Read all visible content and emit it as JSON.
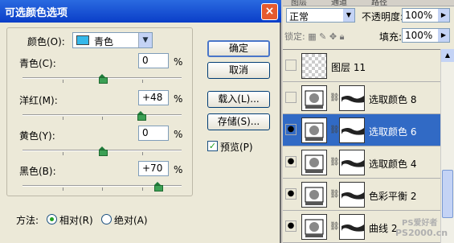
{
  "dialog": {
    "title": "可选颜色选项",
    "close_symbol": "×",
    "color_label": "颜色(O):",
    "color_value": "青色",
    "color_swatch": "#35b8ea",
    "sliders": [
      {
        "label": "青色(C):",
        "value": "0",
        "unit": "%",
        "level": 0
      },
      {
        "label": "洋红(M):",
        "value": "+48",
        "unit": "%",
        "level": 48
      },
      {
        "label": "黄色(Y):",
        "value": "0",
        "unit": "%",
        "level": 0
      },
      {
        "label": "黑色(B):",
        "value": "+70",
        "unit": "%",
        "level": 70
      }
    ],
    "buttons": {
      "ok": "确定",
      "cancel": "取消",
      "load": "载入(L)...",
      "save": "存储(S)..."
    },
    "preview_label": "预览(P)",
    "preview_checked": true,
    "method_label": "方法:",
    "method_relative": "相对(R)",
    "method_absolute": "绝对(A)",
    "method_selected": "relative"
  },
  "layers_panel": {
    "tabs": [
      "图层",
      "通道",
      "路径"
    ],
    "blend_mode": "正常",
    "opacity_label": "不透明度:",
    "opacity_value": "100%",
    "lock_label": "锁定:",
    "fill_label": "填充:",
    "fill_value": "100%",
    "layers": [
      {
        "name": "图层 11",
        "type": "pixel",
        "selected": false,
        "visible": false
      },
      {
        "name": "选取颜色 8",
        "type": "adjustment",
        "selected": false,
        "visible": false
      },
      {
        "name": "选取颜色 6",
        "type": "adjustment",
        "selected": true,
        "visible": true
      },
      {
        "name": "选取颜色 4",
        "type": "adjustment",
        "selected": false,
        "visible": true
      },
      {
        "name": "色彩平衡 2",
        "type": "adjustment",
        "selected": false,
        "visible": true
      },
      {
        "name": "曲线 2",
        "type": "adjustment",
        "selected": false,
        "visible": true
      }
    ]
  },
  "watermark": {
    "line1": "PS爱好者",
    "line2": "PS2000.cn"
  }
}
